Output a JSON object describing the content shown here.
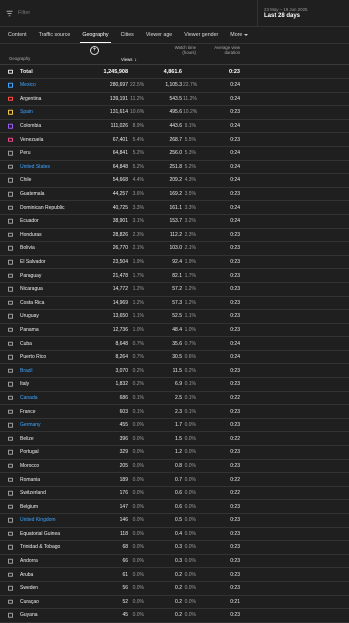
{
  "filter": {
    "placeholder": "Filter",
    "icon": "filter-icon"
  },
  "date": {
    "range": "23 May – 19 Jun 2025",
    "label": "Last 28 days"
  },
  "tabs": [
    {
      "label": "Content",
      "active": false
    },
    {
      "label": "Traffic source",
      "active": false
    },
    {
      "label": "Geography",
      "active": true
    },
    {
      "label": "Cities",
      "active": false
    },
    {
      "label": "Viewer age",
      "active": false
    },
    {
      "label": "Viewer gender",
      "active": false
    },
    {
      "label": "More",
      "active": false
    }
  ],
  "table": {
    "headers": {
      "geography": "Geography",
      "views": "Views",
      "sort_icon": "↓",
      "watch_time_1": "Watch time",
      "watch_time_2": "(hours)",
      "avg_1": "Average view",
      "avg_2": "duration"
    },
    "total": {
      "label": "Total",
      "views": "1,245,908",
      "watch": "4,861.6",
      "avg": "0:23"
    },
    "link_color": "#3ea6ff",
    "rows": [
      {
        "name": "Mexico",
        "views": "280,697",
        "vpct": "22.5%",
        "watch": "1,105.3",
        "wpct": "22.7%",
        "avg": "0:24",
        "link": true
      },
      {
        "name": "Argentina",
        "views": "139,191",
        "vpct": "11.2%",
        "watch": "543.5",
        "wpct": "11.2%",
        "avg": "0:24",
        "link": false
      },
      {
        "name": "Spain",
        "views": "131,614",
        "vpct": "10.6%",
        "watch": "495.6",
        "wpct": "10.2%",
        "avg": "0:23",
        "link": true
      },
      {
        "name": "Colombia",
        "views": "111,026",
        "vpct": "8.9%",
        "watch": "443.6",
        "wpct": "9.1%",
        "avg": "0:24",
        "link": false
      },
      {
        "name": "Venezuela",
        "views": "67,401",
        "vpct": "5.4%",
        "watch": "268.7",
        "wpct": "5.5%",
        "avg": "0:23",
        "link": false
      },
      {
        "name": "Peru",
        "views": "64,841",
        "vpct": "5.2%",
        "watch": "256.0",
        "wpct": "5.3%",
        "avg": "0:24",
        "link": false
      },
      {
        "name": "United States",
        "views": "64,848",
        "vpct": "5.2%",
        "watch": "251.8",
        "wpct": "5.2%",
        "avg": "0:24",
        "link": true
      },
      {
        "name": "Chile",
        "views": "54,668",
        "vpct": "4.4%",
        "watch": "209.2",
        "wpct": "4.3%",
        "avg": "0:24",
        "link": false
      },
      {
        "name": "Guatemala",
        "views": "44,257",
        "vpct": "3.6%",
        "watch": "169.2",
        "wpct": "3.5%",
        "avg": "0:23",
        "link": false
      },
      {
        "name": "Dominican Republic",
        "views": "40,725",
        "vpct": "3.3%",
        "watch": "161.1",
        "wpct": "3.3%",
        "avg": "0:24",
        "link": false
      },
      {
        "name": "Ecuador",
        "views": "38,901",
        "vpct": "3.1%",
        "watch": "153.7",
        "wpct": "3.2%",
        "avg": "0:24",
        "link": false
      },
      {
        "name": "Honduras",
        "views": "28,826",
        "vpct": "2.3%",
        "watch": "112.2",
        "wpct": "2.3%",
        "avg": "0:23",
        "link": false
      },
      {
        "name": "Bolivia",
        "views": "26,770",
        "vpct": "2.1%",
        "watch": "103.0",
        "wpct": "2.1%",
        "avg": "0:23",
        "link": false
      },
      {
        "name": "El Salvador",
        "views": "23,504",
        "vpct": "1.9%",
        "watch": "92.4",
        "wpct": "1.9%",
        "avg": "0:23",
        "link": false
      },
      {
        "name": "Paraguay",
        "views": "21,478",
        "vpct": "1.7%",
        "watch": "82.1",
        "wpct": "1.7%",
        "avg": "0:23",
        "link": false
      },
      {
        "name": "Nicaragua",
        "views": "14,772",
        "vpct": "1.2%",
        "watch": "57.2",
        "wpct": "1.2%",
        "avg": "0:23",
        "link": false
      },
      {
        "name": "Costa Rica",
        "views": "14,969",
        "vpct": "1.2%",
        "watch": "57.3",
        "wpct": "1.2%",
        "avg": "0:23",
        "link": false
      },
      {
        "name": "Uruguay",
        "views": "13,650",
        "vpct": "1.1%",
        "watch": "52.5",
        "wpct": "1.1%",
        "avg": "0:23",
        "link": false
      },
      {
        "name": "Panama",
        "views": "12,736",
        "vpct": "1.0%",
        "watch": "48.4",
        "wpct": "1.0%",
        "avg": "0:23",
        "link": false
      },
      {
        "name": "Cuba",
        "views": "8,648",
        "vpct": "0.7%",
        "watch": "35.6",
        "wpct": "0.7%",
        "avg": "0:24",
        "link": false
      },
      {
        "name": "Puerto Rico",
        "views": "8,264",
        "vpct": "0.7%",
        "watch": "30.5",
        "wpct": "0.6%",
        "avg": "0:24",
        "link": false
      },
      {
        "name": "Brazil",
        "views": "3,070",
        "vpct": "0.2%",
        "watch": "11.5",
        "wpct": "0.2%",
        "avg": "0:23",
        "link": true
      },
      {
        "name": "Italy",
        "views": "1,832",
        "vpct": "0.2%",
        "watch": "6.9",
        "wpct": "0.1%",
        "avg": "0:23",
        "link": false
      },
      {
        "name": "Canada",
        "views": "686",
        "vpct": "0.1%",
        "watch": "2.5",
        "wpct": "0.1%",
        "avg": "0:22",
        "link": true
      },
      {
        "name": "France",
        "views": "603",
        "vpct": "0.1%",
        "watch": "2.3",
        "wpct": "0.1%",
        "avg": "0:23",
        "link": false
      },
      {
        "name": "Germany",
        "views": "455",
        "vpct": "0.0%",
        "watch": "1.7",
        "wpct": "0.0%",
        "avg": "0:23",
        "link": true
      },
      {
        "name": "Belize",
        "views": "396",
        "vpct": "0.0%",
        "watch": "1.5",
        "wpct": "0.0%",
        "avg": "0:22",
        "link": false
      },
      {
        "name": "Portugal",
        "views": "329",
        "vpct": "0.0%",
        "watch": "1.2",
        "wpct": "0.0%",
        "avg": "0:23",
        "link": false
      },
      {
        "name": "Morocco",
        "views": "205",
        "vpct": "0.0%",
        "watch": "0.8",
        "wpct": "0.0%",
        "avg": "0:23",
        "link": false
      },
      {
        "name": "Romania",
        "views": "189",
        "vpct": "0.0%",
        "watch": "0.7",
        "wpct": "0.0%",
        "avg": "0:22",
        "link": false
      },
      {
        "name": "Switzerland",
        "views": "176",
        "vpct": "0.0%",
        "watch": "0.6",
        "wpct": "0.0%",
        "avg": "0:22",
        "link": false
      },
      {
        "name": "Belgium",
        "views": "147",
        "vpct": "0.0%",
        "watch": "0.6",
        "wpct": "0.0%",
        "avg": "0:23",
        "link": false
      },
      {
        "name": "United Kingdom",
        "views": "146",
        "vpct": "0.0%",
        "watch": "0.5",
        "wpct": "0.0%",
        "avg": "0:23",
        "link": true
      },
      {
        "name": "Equatorial Guinea",
        "views": "118",
        "vpct": "0.0%",
        "watch": "0.4",
        "wpct": "0.0%",
        "avg": "0:23",
        "link": false
      },
      {
        "name": "Trinidad & Tobago",
        "views": "68",
        "vpct": "0.0%",
        "watch": "0.3",
        "wpct": "0.0%",
        "avg": "0:23",
        "link": false
      },
      {
        "name": "Andorra",
        "views": "66",
        "vpct": "0.0%",
        "watch": "0.3",
        "wpct": "0.0%",
        "avg": "0:23",
        "link": false
      },
      {
        "name": "Aruba",
        "views": "61",
        "vpct": "0.0%",
        "watch": "0.2",
        "wpct": "0.0%",
        "avg": "0:23",
        "link": false
      },
      {
        "name": "Sweden",
        "views": "56",
        "vpct": "0.0%",
        "watch": "0.2",
        "wpct": "0.0%",
        "avg": "0:23",
        "link": false
      },
      {
        "name": "Curaçao",
        "views": "52",
        "vpct": "0.0%",
        "watch": "0.2",
        "wpct": "0.0%",
        "avg": "0:21",
        "link": false
      },
      {
        "name": "Guyana",
        "views": "45",
        "vpct": "0.0%",
        "watch": "0.2",
        "wpct": "0.0%",
        "avg": "0:23",
        "link": false
      }
    ]
  },
  "row_checkbox_colors": [
    "#3ea6ff",
    "#ff4e45",
    "#f2c94c",
    "#9b5cf6",
    "#e84a8a"
  ]
}
